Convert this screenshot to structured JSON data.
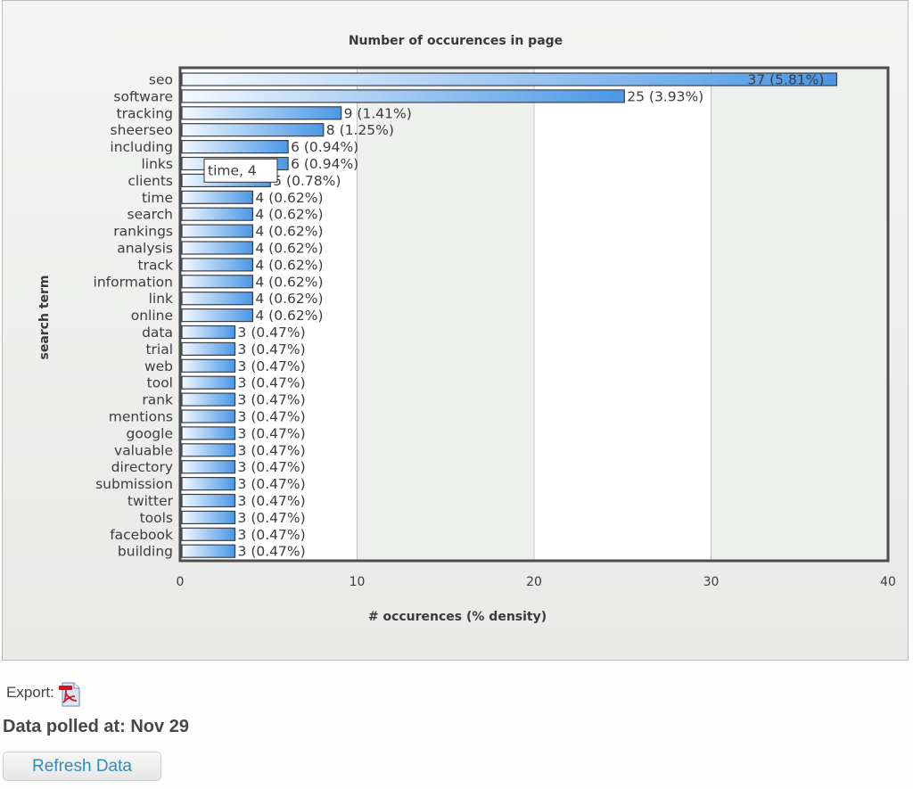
{
  "chart_data": {
    "type": "bar",
    "orientation": "horizontal",
    "title": "Number of occurences in page",
    "xlabel": "# occurences (% density)",
    "ylabel": "search term",
    "xlim": [
      0,
      40
    ],
    "xticks": [
      "0",
      "10",
      "20",
      "30",
      "40"
    ],
    "grid": true,
    "legend": "none",
    "categories": [
      "seo",
      "software",
      "tracking",
      "sheerseo",
      "including",
      "links",
      "clients",
      "time",
      "search",
      "rankings",
      "analysis",
      "track",
      "information",
      "link",
      "online",
      "data",
      "trial",
      "web",
      "tool",
      "rank",
      "mentions",
      "google",
      "valuable",
      "directory",
      "submission",
      "twitter",
      "tools",
      "facebook",
      "building"
    ],
    "values": [
      37,
      25,
      9,
      8,
      6,
      6,
      5,
      4,
      4,
      4,
      4,
      4,
      4,
      4,
      4,
      3,
      3,
      3,
      3,
      3,
      3,
      3,
      3,
      3,
      3,
      3,
      3,
      3,
      3
    ],
    "densities": [
      "5.81%",
      "3.93%",
      "1.41%",
      "1.25%",
      "0.94%",
      "0.94%",
      "0.78%",
      "0.62%",
      "0.62%",
      "0.62%",
      "0.62%",
      "0.62%",
      "0.62%",
      "0.62%",
      "0.62%",
      "0.47%",
      "0.47%",
      "0.47%",
      "0.47%",
      "0.47%",
      "0.47%",
      "0.47%",
      "0.47%",
      "0.47%",
      "0.47%",
      "0.47%",
      "0.47%",
      "0.47%",
      "0.47%"
    ],
    "data_labels": [
      "37 (5.81%)",
      "25 (3.93%)",
      "9 (1.41%)",
      "8 (1.25%)",
      "6 (0.94%)",
      "6 (0.94%)",
      "5 (0.78%)",
      "4 (0.62%)",
      "4 (0.62%)",
      "4 (0.62%)",
      "4 (0.62%)",
      "4 (0.62%)",
      "4 (0.62%)",
      "4 (0.62%)",
      "4 (0.62%)",
      "3 (0.47%)",
      "3 (0.47%)",
      "3 (0.47%)",
      "3 (0.47%)",
      "3 (0.47%)",
      "3 (0.47%)",
      "3 (0.47%)",
      "3 (0.47%)",
      "3 (0.47%)",
      "3 (0.47%)",
      "3 (0.47%)",
      "3 (0.47%)",
      "3 (0.47%)",
      "3 (0.47%)"
    ],
    "tooltip": {
      "text": "time, 4",
      "category": "time",
      "value": 4
    },
    "colors": {
      "bar_start": "#f4f9ff",
      "bar_end": "#4a97e6",
      "bar_stroke": "#3a3f45",
      "plot_border": "#4d4d4d",
      "band": "#eef0ee",
      "gridline": "#c4c4c4"
    }
  },
  "export": {
    "label": "Export:",
    "icon": "pdf-icon"
  },
  "polled": {
    "text": "Data polled at: Nov 29"
  },
  "refresh": {
    "label": "Refresh Data"
  }
}
